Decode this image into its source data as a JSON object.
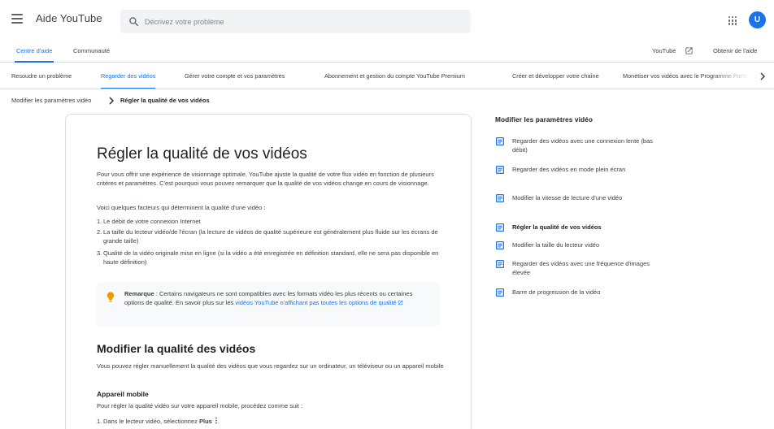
{
  "header": {
    "app_title": "Aide YouTube",
    "search_placeholder": "Décrivez votre problème",
    "avatar_letter": "U"
  },
  "subnav": {
    "tabs": [
      "Centre d'aide",
      "Communauté"
    ],
    "active_tab": "Centre d'aide",
    "youtube_link": "YouTube",
    "help_link": "Obtenir de l'aide"
  },
  "categories": {
    "items": [
      "Resoudre un problème",
      "Regarder des vidéos",
      "Gérer votre compte et vos paramètres",
      "Abonnement et gestion du compte YouTube Premium",
      "Créer et développer votre chaîne",
      "Monétiser vos vidéos avec le Programme Partenaire YouTube"
    ],
    "active": "Regarder des vidéos"
  },
  "breadcrumb": {
    "parent": "Modifier les paramètres vidéo",
    "current": "Régler la qualité de vos vidéos"
  },
  "article": {
    "title": "Régler la qualité de vos vidéos",
    "intro": "Pour vous offrir une expérience de visionnage optimale, YouTube ajuste la qualité de votre flux vidéo en fonction de plusieurs critères et paramètres. C'est pourquoi vous pouvez remarquer que la qualité de vos vidéos change en cours de visionnage.",
    "factors_intro": "Voici quelques facteurs qui déterminent la qualité d'une vidéo :",
    "factors": [
      {
        "num": "1.",
        "text": "Le débit de votre connexion Internet"
      },
      {
        "num": "2.",
        "text": "La taille du lecteur vidéo/de l'écran (la lecture de vidéos de qualité supérieure est généralement plus fluide sur les écrans de grande taille)"
      },
      {
        "num": "3.",
        "text": "Qualité de la vidéo originale mise en ligne (si la vidéo a été enregistrée en définition standard, elle ne sera pas disponible en haute définition)"
      }
    ],
    "note": {
      "label": "Remarque",
      "text": " : Certains navigateurs ne sont compatibles avec les formats vidéo les plus récents ou certaines options de qualité. En savoir plus sur les ",
      "link": "vidéos YouTube n'affichant pas toutes les options de qualité"
    },
    "section_title": "Modifier la qualité des vidéos",
    "section_text": "Vous pouvez régler manuellement la qualité des vidéos que vous regardez sur un ordinateur, un téléviseur ou un appareil mobile",
    "subsection_title": "Appareil mobile",
    "subsection_text": "Pour régler la qualité vidéo sur votre appareil mobile, procédez comme suit :",
    "step1_num": "1.",
    "step1_text": "Dans le lecteur vidéo, sélectionnez ",
    "step1_bold": "Plus",
    "step1_end": "."
  },
  "sidebar": {
    "title": "Modifier les paramètres vidéo",
    "items": [
      "Regarder des vidéos avec une connexion lente (bas débit)",
      "Regarder des vidéos en mode plein écran",
      "Modifier la vitesse de lecture d'une vidéo",
      "Régler la qualité de vos vidéos",
      "Modifier la taille du lecteur vidéo",
      "Regarder des vidéos avec une fréquence d'images élevée",
      "Barre de progression de la vidéo"
    ],
    "current": "Régler la qualité de vos vidéos"
  },
  "colors": {
    "accent": "#1a73e8",
    "text": "#3c4043",
    "heading": "#202124",
    "border": "#dadce0",
    "note_bg": "#f8f9fa",
    "bulb": "#f29900"
  },
  "icons": {
    "menu": "hamburger-icon",
    "search": "search-icon",
    "apps": "apps-grid-icon",
    "external": "open-in-new-icon",
    "next": "chevron-right-icon",
    "breadcrumb_sep": "chevron-right-icon",
    "note": "lightbulb-icon",
    "sidebar_item": "document-icon",
    "more": "more-vert-icon"
  }
}
